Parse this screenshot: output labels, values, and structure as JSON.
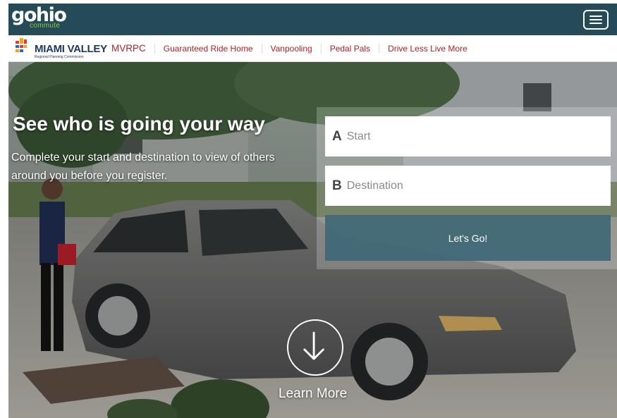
{
  "header": {
    "logo_text": "gohio",
    "logo_subtext": "commute",
    "menu_icon": "hamburger-menu-icon"
  },
  "subnav": {
    "org_logo_text": "MIAMI VALLEY",
    "org_logo_subtext": "Regional Planning Commission",
    "links": [
      "MVRPC",
      "Guaranteed Ride Home",
      "Vanpooling",
      "Pedal Pals",
      "Drive Less Live More"
    ]
  },
  "hero": {
    "headline": "See who is going your way",
    "subline": "Complete your start and destination to view of others around you before you register.",
    "start_letter": "A",
    "start_placeholder": "Start",
    "destination_letter": "B",
    "destination_placeholder": "Destination",
    "go_button": "Let's Go!",
    "learn_more": "Learn More",
    "learn_more_icon": "arrow-down-circle-icon"
  },
  "colors": {
    "header_bg": "#254a58",
    "nav_link": "#b0202a",
    "go_button_bg": "#406876",
    "logo_accent": "#8fc640"
  }
}
